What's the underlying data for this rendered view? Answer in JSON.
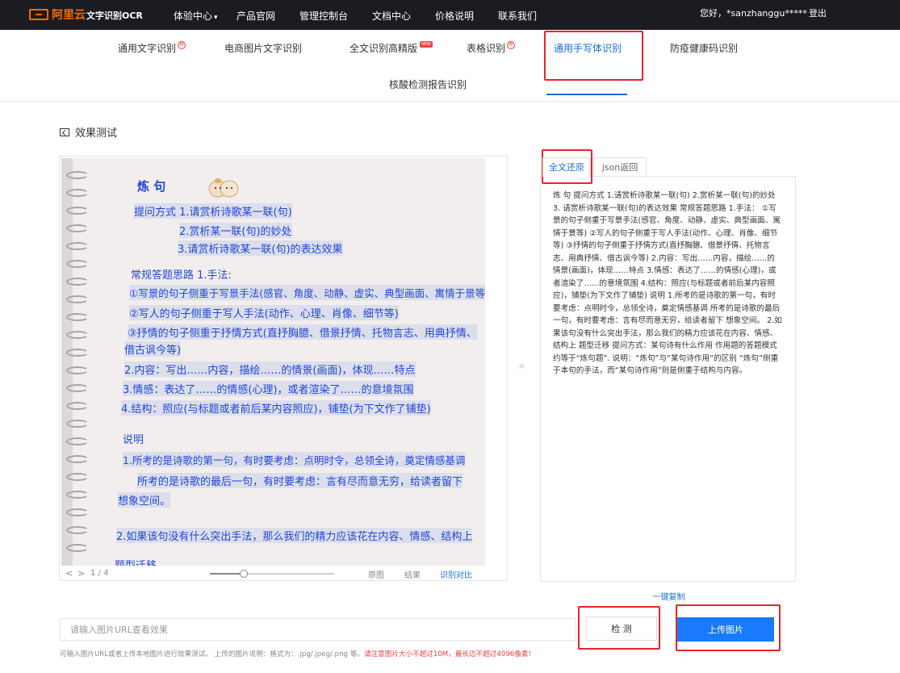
{
  "topbar": {
    "logo": "阿里云",
    "product": "文字识别OCR",
    "nav": [
      "体验中心",
      "产品官网",
      "管理控制台",
      "文档中心",
      "价格说明",
      "联系我们"
    ],
    "greeting": "您好，*sanzhanggu*****",
    "logout": "登出"
  },
  "tabs": [
    {
      "label": "通用文字识别",
      "badge": "荐"
    },
    {
      "label": "电商图片文字识别",
      "badge": ""
    },
    {
      "label": "全文识别高精版",
      "badge": "NEW"
    },
    {
      "label": "表格识别",
      "badge": "荐"
    },
    {
      "label": "通用手写体识别",
      "badge": "",
      "active": true
    },
    {
      "label": "防疫健康码识别",
      "badge": ""
    },
    {
      "label": "核酸检测报告识别",
      "badge": ""
    }
  ],
  "section_title": "效果测试",
  "ocr_image": {
    "lines": [
      "炼 句",
      "提问方式 1.请赏析诗歌某一联(句)",
      "2.赏析某一联(句)的妙处",
      "3.请赏析诗歌某一联(句)的表达效果",
      "常规答题思路    1.手法:",
      "①写景的句子侧重于写景手法(感官、角度、动静、虚实、典型画面、寓情于景等)",
      "②写人的句子侧重于写人手法(动作、心理、肖像、细节等)",
      "③抒情的句子侧重于抒情方式(直抒胸臆、借景抒情、托物言志、用典抒情、",
      "借古讽今等)",
      "2.内容：写出……内容，描绘……的情景(画面)，体现……特点",
      "3.情感：表达了……的情感(心理)，或者渲染了……的意境氛围",
      "4.结构：照应(与标题或者前后某内容照应)，铺垫(为下文作了铺垫)",
      "说明",
      "1.所考的是诗歌的第一句，有时要考虑：点明时令，总领全诗，奠定情感基调",
      "所考的是诗歌的最后一句，有时要考虑：言有尽而意无穷，给读者留下",
      "想象空间。",
      "2.如果该句没有什么突出手法，那么我们的精力应该花在内容、情感、结构上",
      "题型迁移"
    ]
  },
  "image_controls": {
    "page": "1 / 4",
    "zoom_fraction": 0.27,
    "views": [
      "原图",
      "结果",
      "识别对比"
    ],
    "active_view": "识别对比"
  },
  "result": {
    "tabs": [
      "全文还原",
      "json返回"
    ],
    "active_tab": "全文还原",
    "text": "炼 句 提问方式 1.请赏析诗歌某一联(句) 2.赏析某一联(句)的妙处 3. 请赏析诗歌某一联(句)的表达效果 常规答题思路 1.手法： ①写景的句子侧重于写景手法(感官、角度、动静、虚实、典型画面、寓情于景等) ②写人的句子侧重于写人手法(动作、心理、肖像、细节等) ③抒情的句子侧重于抒情方式(直抒胸臆、借景抒情、托物言志、用典抒情、借古讽今等) 2.内容：写出……内容，描绘……的情景(画面)，体现……特点 3.情感：表达了……的情感(心理)，或者渲染了……的意境氛围 4.结构：照应(与标题或者前后某内容照应)，铺垫(为下文作了铺垫) 说明 1.所考的是诗歌的第一句，有时要考虑：点明时令，总领全诗，奠定情感基调 所考的是诗歌的最后一句，有时要考虑：言有尽而意无穷，给读者留下 想象空间。 2.如果该句没有什么突出手法，那么我们的精力应该花在内容、情感、结构上 题型迁移 提问方式：某句诗有什么作用 作用题的答题模式约等于“炼句题”. 说明：“炼句”与“某句诗作用”的区别 “炼句”侧重于本句的手法，而“某句诗作用”则是侧重于结构与内容。",
    "copy_label": "一键复制"
  },
  "input": {
    "placeholder": "请输入图片URL查看效果",
    "detect_label": "检 测",
    "upload_label": "上传图片"
  },
  "hint": {
    "normal": "可输入图片URL或者上传本地图片进行效果测试。 上传的图片说明：格式为：.jpg/.jpeg/.png 等。",
    "warning": "请注意图片大小不超过10M，最长边不超过4096像素!"
  },
  "colors": {
    "accent": "#1a6fd8",
    "upload_button": "#1979ff",
    "highlight_box": "#e8242a",
    "brand": "#ff6a00",
    "topbar": "#1b1b22"
  }
}
